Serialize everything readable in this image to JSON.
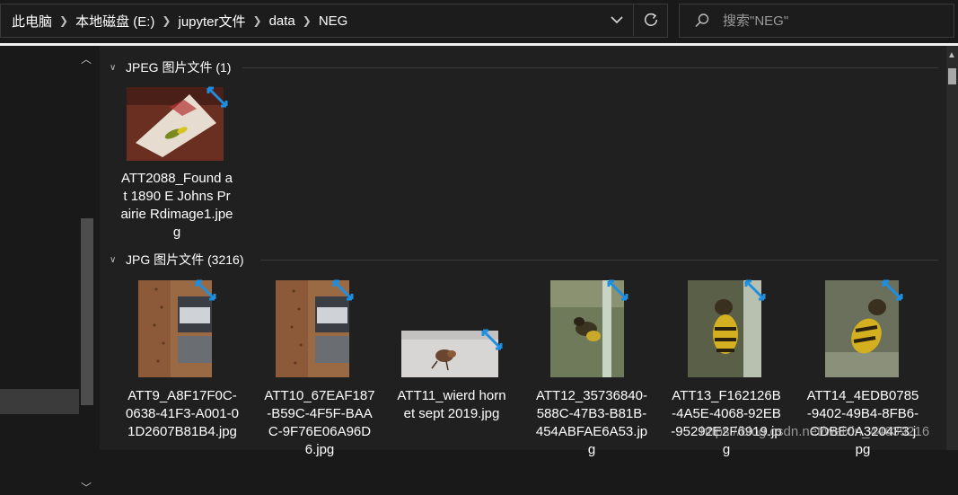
{
  "breadcrumb": {
    "items": [
      "此电脑",
      "本地磁盘 (E:)",
      "jupyter文件",
      "data",
      "NEG"
    ]
  },
  "search": {
    "placeholder": "搜索\"NEG\""
  },
  "groups": [
    {
      "label": "JPEG 图片文件 (1)"
    },
    {
      "label": "JPG 图片文件 (3216)"
    }
  ],
  "files": [
    {
      "name": "ATT2088_Found at 1890 E Johns Prairie Rdimage1.jpeg"
    },
    {
      "name": "ATT9_A8F17F0C-0638-41F3-A001-01D2607B81B4.jpg"
    },
    {
      "name": "ATT10_67EAF187-B59C-4F5F-BAAC-9F76E06A96D6.jpg"
    },
    {
      "name": "ATT11_wierd hornet sept 2019.jpg"
    },
    {
      "name": "ATT12_35736840-588C-47B3-B81B-454ABFAE6A53.jpg"
    },
    {
      "name": "ATT13_F162126B-4A5E-4068-92EB-95292E2F6919.jpg"
    },
    {
      "name": "ATT14_4EDB0785-9402-49B4-8FB6-CDBE0A3204F3.jpg"
    }
  ],
  "watermark": "https://blog.csdn.net/weixin_44639216",
  "icons": {
    "chevron_right": "chevron-right-icon",
    "dropdown": "chevron-down-icon",
    "refresh": "refresh-icon",
    "search": "search-icon",
    "sync": "sync-icon"
  },
  "colors": {
    "accent": "#1e8fe0",
    "background": "#202020",
    "text": "#ffffff"
  }
}
